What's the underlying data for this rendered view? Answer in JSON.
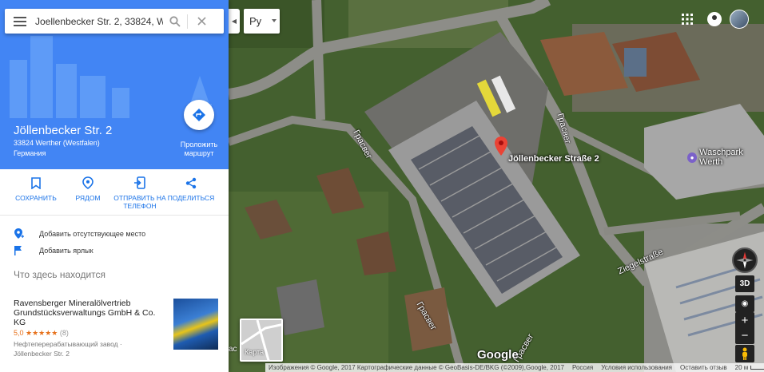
{
  "search": {
    "value": "Joellenbecker Str. 2, 33824, Werther",
    "placeholder": ""
  },
  "place": {
    "title": "Jöllenbecker Str. 2",
    "address": "33824 Werther (Westfalen)",
    "country": "Германия"
  },
  "route": {
    "label": "Проложить маршрут"
  },
  "actions": [
    {
      "label": "СОХРАНИТЬ",
      "icon": "bookmark-icon"
    },
    {
      "label": "РЯДОМ",
      "icon": "nearby-icon"
    },
    {
      "label": "ОТПРАВИТЬ НА ТЕЛЕФОН",
      "icon": "send-to-phone-icon"
    },
    {
      "label": "ПОДЕЛИТЬСЯ",
      "icon": "share-icon"
    }
  ],
  "add_links": [
    {
      "label": "Добавить отсутствующее место",
      "icon": "add-place-icon"
    },
    {
      "label": "Добавить ярлык",
      "icon": "flag-icon"
    }
  ],
  "section": {
    "heading": "Что здесь находится"
  },
  "result": {
    "name": "Ravensberger Mineralölvertrieb Grundstücksverwaltungs GmbH & Co. KG",
    "rating": "5,0",
    "stars": "★★★★★",
    "count": "(8)",
    "category": "Нефтеперерабатывающий завод ·",
    "address": "Jöllenbecker Str. 2"
  },
  "map": {
    "language": "Ру",
    "pin_label": "Jöllenbecker Straße 2",
    "poi_label": "Waschpark Werth",
    "road_labels": [
      "Грасвег",
      "Грасвег",
      "Ziegelstraße",
      "Грасвег",
      "Грасвег"
    ],
    "button_3d": "3D",
    "minimap_label": "Карта",
    "minimap_side": "ас",
    "logo": "Google",
    "attribution": "Изображения © Google, 2017 Картографические данные © GeoBasis-DE/BKG (©2009),Google, 2017",
    "country": "Россия",
    "terms": "Условия использования",
    "feedback": "Оставить отзыв",
    "scale": "20 м"
  },
  "colors": {
    "accent": "#4285f4",
    "action_blue": "#1a73e8",
    "pin_red": "#ea4335",
    "star_orange": "#e7711b"
  }
}
